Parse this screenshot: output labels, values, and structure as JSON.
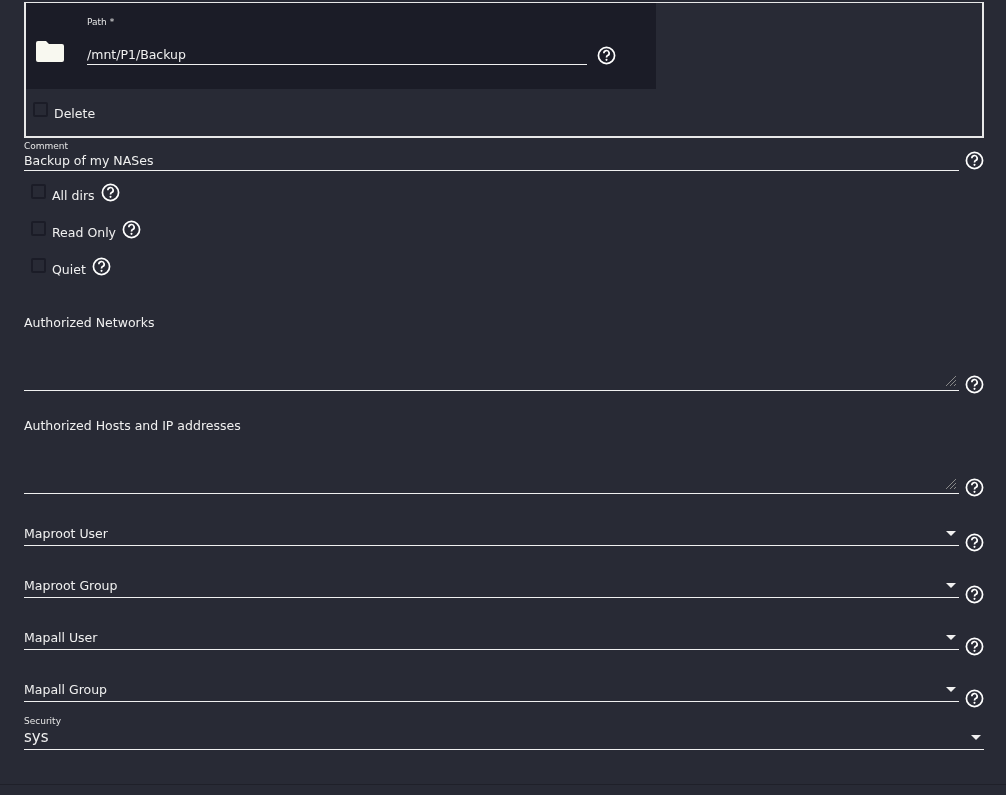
{
  "path": {
    "label": "Path *",
    "value": "/mnt/P1/Backup",
    "delete": {
      "label": "Delete",
      "checked": false
    }
  },
  "fields": [
    {
      "kind": "text",
      "label": "Comment",
      "value": "Backup of my NASes"
    },
    {
      "kind": "checkbox",
      "label": "All dirs",
      "checked": false
    },
    {
      "kind": "checkbox",
      "label": "Read Only",
      "checked": false
    },
    {
      "kind": "checkbox",
      "label": "Quiet",
      "checked": false
    },
    {
      "kind": "textarea",
      "label": "Authorized Networks"
    },
    {
      "kind": "textarea",
      "label": "Authorized Hosts and IP addresses"
    },
    {
      "kind": "select",
      "label": "Maproot User"
    },
    {
      "kind": "select",
      "label": "Maproot Group"
    },
    {
      "kind": "select",
      "label": "Mapall User"
    },
    {
      "kind": "select",
      "label": "Mapall Group"
    },
    {
      "kind": "choice",
      "label": "Security",
      "value": "sys"
    }
  ]
}
